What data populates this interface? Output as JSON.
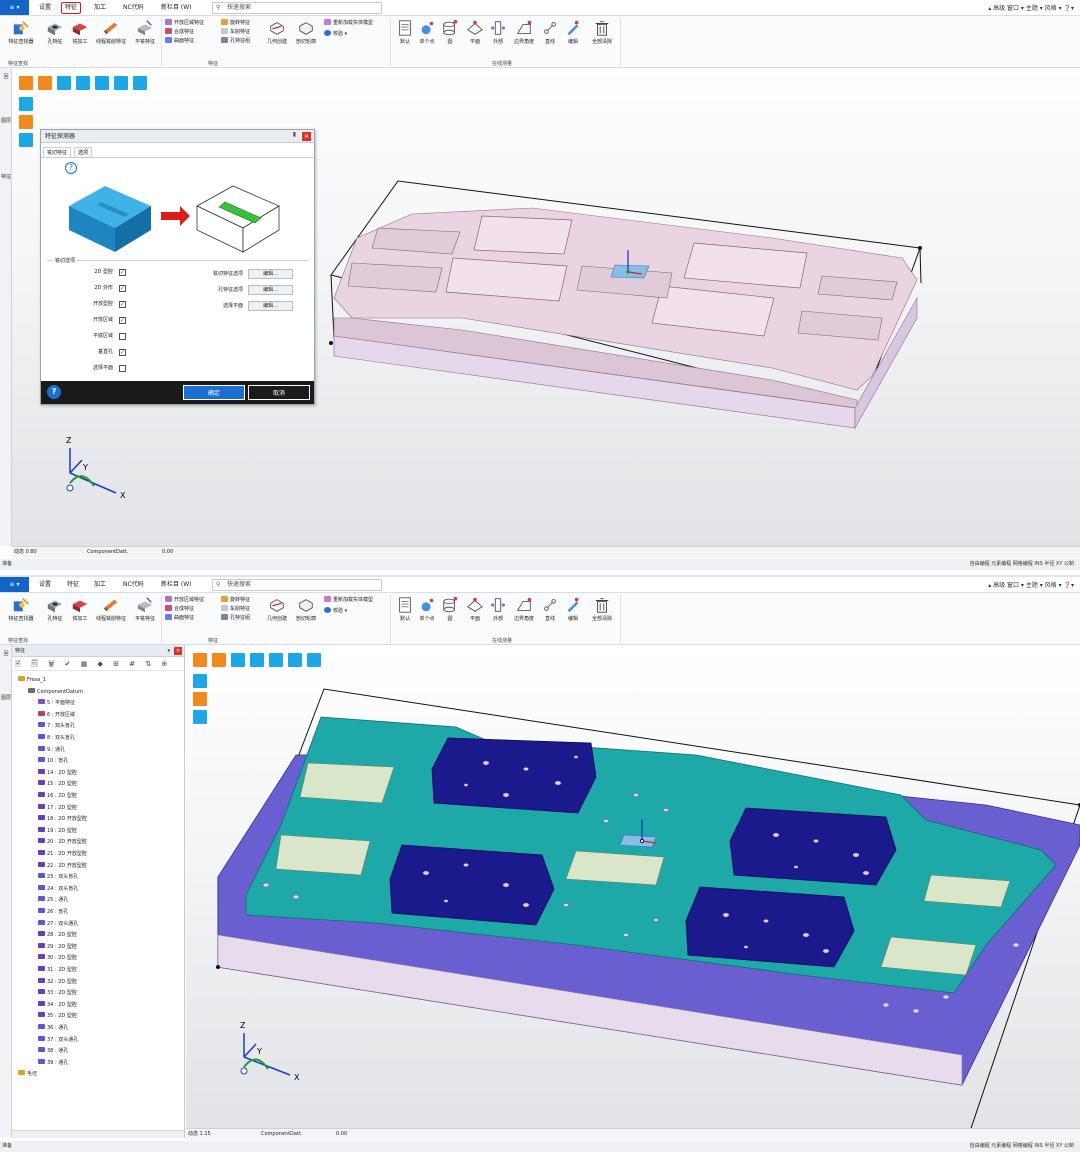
{
  "top": {
    "menubar": {
      "file_label": "≡ ▾",
      "tabs": [
        "设置",
        "特征",
        "加工",
        "NC代码",
        "新栏目 (W)"
      ],
      "search_placeholder": "快速搜索",
      "right_text": "▴ 高级   窗口 ▾  主题 ▾  风格 ▾  ❓▾"
    },
    "ribbon": {
      "big_buttons": [
        "特征查找器",
        "孔特征",
        "铣加工",
        "线程铣削特征",
        "平铣特征"
      ],
      "small_col1": [
        "开放区域特征",
        "合成特征",
        "曲面特征"
      ],
      "small_col2": [
        "旋转特征",
        "车削特征",
        "孔特征组"
      ],
      "geo_buttons": [
        "几何创建",
        "剖切轮廓"
      ],
      "small_col3": [
        "重新加载实体模型",
        "校验 ▾"
      ],
      "measure_buttons": [
        "默认",
        "单个点",
        "圆",
        "平面",
        "外部",
        "边界角度",
        "直线",
        "编辑",
        "全部清除"
      ],
      "group_labels": [
        "特征查找",
        "特征",
        "在线测量"
      ]
    },
    "left_tabs": [
      "回",
      "图层",
      "特征"
    ],
    "dialog": {
      "title": "特征探测器",
      "tabs": [
        "铣切特征",
        "选项"
      ],
      "group_label": "铣切选项",
      "options": [
        {
          "label": "2D 型腔",
          "checked": "✓"
        },
        {
          "label": "2D 外形",
          "checked": "✓"
        },
        {
          "label": "开放型腔",
          "checked": "✓"
        },
        {
          "label": "开放区域",
          "checked": "✓"
        },
        {
          "label": "平底区域",
          "checked": ""
        },
        {
          "label": "垂直孔",
          "checked": "✓"
        },
        {
          "label": "选择平面",
          "checked": ""
        }
      ],
      "right_labels": [
        "铣切特征选项",
        "孔特征选项",
        "选择平面"
      ],
      "edit_label": "编辑...",
      "ok_label": "确定",
      "cancel_label": "取消",
      "help_label": "?"
    },
    "status": {
      "dynamic": "动态 0.80",
      "component": "ComponentDatt.",
      "value": "0.00"
    },
    "bottom_left": "准备",
    "bottom_right": "自由编程  元素编程  网格编程  INS  半径  XY  公制"
  },
  "bottom": {
    "tree": {
      "header": "特征",
      "tools": "🗎 🗐 🗑 ✔ ▦ ◆ ⊞ # ⇅ ⊕",
      "items": [
        {
          "text": "Fresa_1",
          "level": 0,
          "color": "#e0a020"
        },
        {
          "text": "ComponentDatum",
          "level": 1,
          "color": "#6b6b6b"
        },
        {
          "text": "5 : 平面特征",
          "level": 2,
          "color": "#8a50b8"
        },
        {
          "text": "6 : 开放区域",
          "level": 2,
          "color": "#c04060"
        },
        {
          "text": "7 : 双头盲孔",
          "level": 2,
          "color": "#5a5ad0"
        },
        {
          "text": "8 : 双头盲孔",
          "level": 2,
          "color": "#5a5ad0"
        },
        {
          "text": "9 : 通孔",
          "level": 2,
          "color": "#5a5ad0"
        },
        {
          "text": "10 : 盲孔",
          "level": 2,
          "color": "#5a5ad0"
        },
        {
          "text": "14 : 2D 型腔",
          "level": 2,
          "color": "#6a40b0"
        },
        {
          "text": "15 : 2D 型腔",
          "level": 2,
          "color": "#6a40b0"
        },
        {
          "text": "16 : 2D 型腔",
          "level": 2,
          "color": "#6a40b0"
        },
        {
          "text": "17 : 2D 型腔",
          "level": 2,
          "color": "#6a40b0"
        },
        {
          "text": "18 : 2D 开放型腔",
          "level": 2,
          "color": "#6a40b0"
        },
        {
          "text": "19 : 2D 型腔",
          "level": 2,
          "color": "#6a40b0"
        },
        {
          "text": "20 : 2D 开放型腔",
          "level": 2,
          "color": "#6a40b0"
        },
        {
          "text": "21 : 2D 开放型腔",
          "level": 2,
          "color": "#6a40b0"
        },
        {
          "text": "22 : 2D 开放型腔",
          "level": 2,
          "color": "#6a40b0"
        },
        {
          "text": "23 : 双头盲孔",
          "level": 2,
          "color": "#5a5ad0"
        },
        {
          "text": "24 : 双头盲孔",
          "level": 2,
          "color": "#5a5ad0"
        },
        {
          "text": "25 : 通孔",
          "level": 2,
          "color": "#5a5ad0"
        },
        {
          "text": "26 : 盲孔",
          "level": 2,
          "color": "#5a5ad0"
        },
        {
          "text": "27 : 双头通孔",
          "level": 2,
          "color": "#5a5ad0"
        },
        {
          "text": "28 : 2D 型腔",
          "level": 2,
          "color": "#6a40b0"
        },
        {
          "text": "29 : 2D 型腔",
          "level": 2,
          "color": "#6a40b0"
        },
        {
          "text": "30 : 2D 型腔",
          "level": 2,
          "color": "#6a40b0"
        },
        {
          "text": "31 : 2D 型腔",
          "level": 2,
          "color": "#6a40b0"
        },
        {
          "text": "32 : 2D 型腔",
          "level": 2,
          "color": "#6a40b0"
        },
        {
          "text": "33 : 2D 型腔",
          "level": 2,
          "color": "#6a40b0"
        },
        {
          "text": "34 : 2D 型腔",
          "level": 2,
          "color": "#6a40b0"
        },
        {
          "text": "35 : 2D 型腔",
          "level": 2,
          "color": "#6a40b0"
        },
        {
          "text": "36 : 通孔",
          "level": 2,
          "color": "#5a5ad0"
        },
        {
          "text": "37 : 双头通孔",
          "level": 2,
          "color": "#5a5ad0"
        },
        {
          "text": "38 : 通孔",
          "level": 2,
          "color": "#5a5ad0"
        },
        {
          "text": "39 : 通孔",
          "level": 2,
          "color": "#5a5ad0"
        },
        {
          "text": "毛坯",
          "level": 0,
          "color": "#e0a020"
        }
      ]
    },
    "status": {
      "dynamic": "动态 1.15",
      "component": "ComponentDatt.",
      "value": "0.00"
    },
    "bottom_left": "准备",
    "bottom_right": "自由编程  元素编程  网格编程  INS  半径  XY  公制"
  },
  "axes": {
    "x": "X",
    "y": "Y",
    "z": "Z"
  },
  "colors": {
    "accent_blue": "#1464c8",
    "highlight_red": "#d21c1c",
    "part_pink": "#e8cfe0",
    "part_teal": "#1fa8a8",
    "part_navy": "#1a1a8c",
    "part_purple": "#6a5fd0"
  }
}
